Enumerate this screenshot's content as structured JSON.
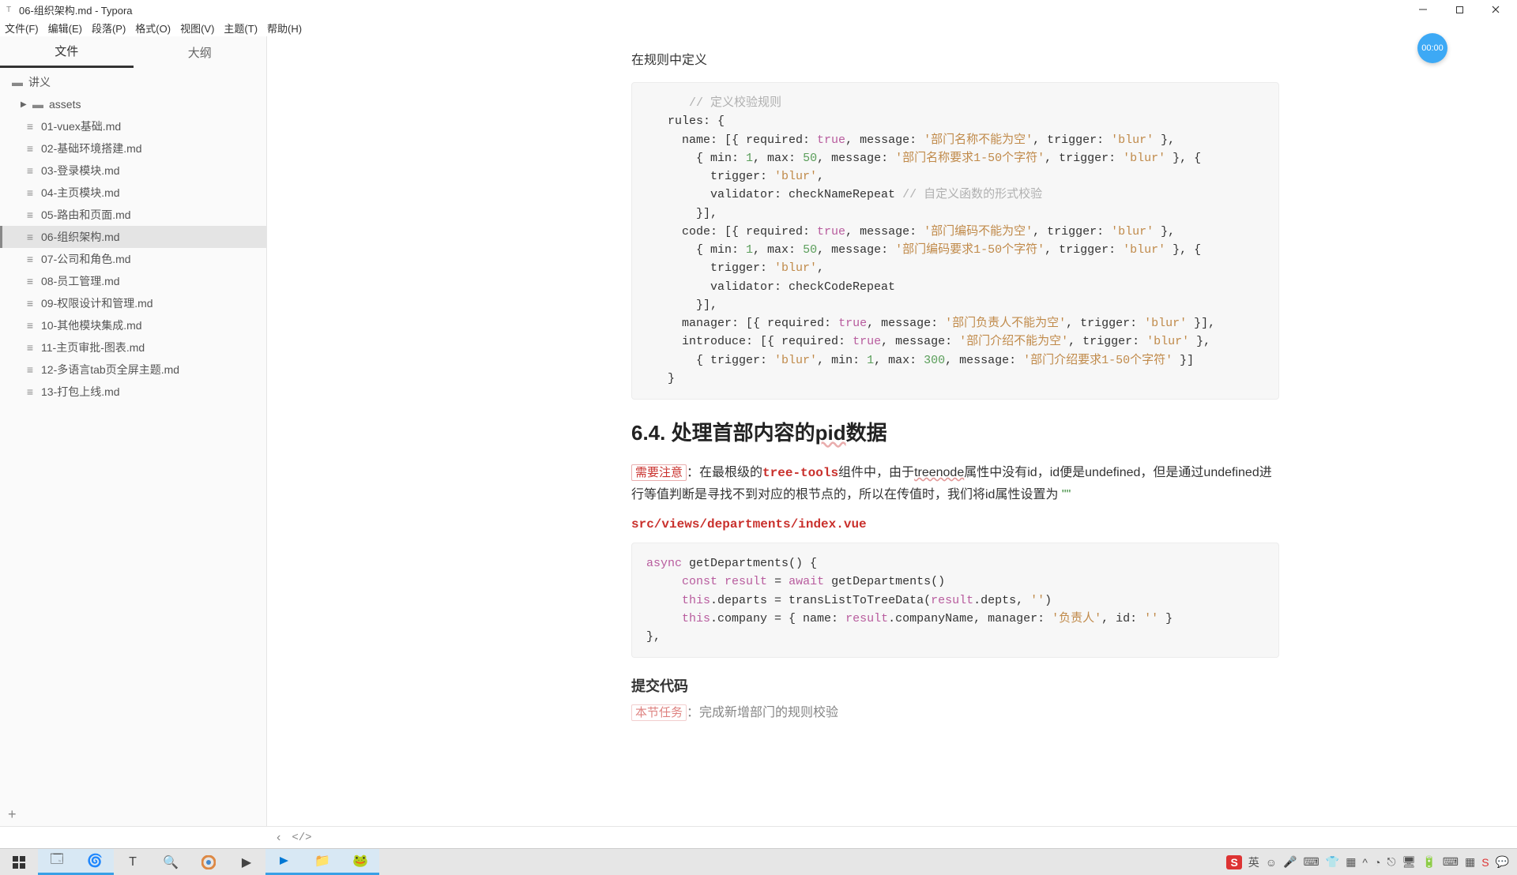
{
  "window": {
    "title": "06-组织架构.md - Typora"
  },
  "menus": [
    "文件(F)",
    "编辑(E)",
    "段落(P)",
    "格式(O)",
    "视图(V)",
    "主题(T)",
    "帮助(H)"
  ],
  "sidebar": {
    "tabs": {
      "files": "文件",
      "outline": "大纲"
    },
    "root": "讲义",
    "folder": "assets",
    "files": [
      "01-vuex基础.md",
      "02-基础环境搭建.md",
      "03-登录模块.md",
      "04-主页模块.md",
      "05-路由和页面.md",
      "06-组织架构.md",
      "07-公司和角色.md",
      "08-员工管理.md",
      "09-权限设计和管理.md",
      "10-其他模块集成.md",
      "11-主页审批-图表.md",
      "12-多语言tab页全屏主题.md",
      "13-打包上线.md"
    ],
    "active_index": 5
  },
  "badge": "00:00",
  "content": {
    "intro_line": "在规则中定义",
    "code1": {
      "line1_comment": "// 定义校验规则",
      "line2": "rules: {",
      "name_label": "name: [{ required: ",
      "true": "true",
      "msg": ", message: ",
      "name_empty": "'部门名称不能为空'",
      "trigger": ", trigger: ",
      "blur": "'blur'",
      "brace_end": " },",
      "min": "{ min: ",
      "one": "1",
      "max": ", max: ",
      "fifty": "50",
      "name_len": "'部门名称要求1-50个字符'",
      "brace_open": " }, {",
      "trigger_only": "trigger: ",
      "comma": ",",
      "validator": "validator: checkNameRepeat ",
      "custom_comment": "// 自定义函数的形式校验",
      "arr_close": "}],",
      "code_label": "code: [{ required: ",
      "code_empty": "'部门编码不能为空'",
      "code_len": "'部门编码要求1-50个字符'",
      "validator2": "validator: checkCodeRepeat",
      "manager_label": "manager: [{ required: ",
      "manager_empty": "'部门负责人不能为空'",
      "arr_close2": " }],",
      "intro_label": "introduce: [{ required: ",
      "intro_empty": "'部门介绍不能为空'",
      "trigger2": "{ trigger: ",
      "min2": ", min: ",
      "max2": ", max: ",
      "three_hundred": "300",
      "intro_len": "'部门介绍要求1-50个字符'",
      "arr_close3": " }]",
      "close_brace": "}"
    },
    "heading": {
      "prefix": "6.4. 处理首部内容的",
      "ul": "pid",
      "suffix": "数据"
    },
    "note_label": "需要注意",
    "para1a": "：在最根级的",
    "tree_tools": "tree-tools",
    "para1b": "组件中，由于",
    "treenode": "treenode",
    "para1c": "属性中没有id，id便是undefined，但是通过undefined进行等值判断是寻找不到对应的根节点的，所以在传值时，我们将id属性设置为",
    "empty_q": "\"\"",
    "srcpath": "src/views/departments/index.vue",
    "code2": {
      "async": "async",
      "fn_sig": " getDepartments() {",
      "const": "const",
      "result": "result",
      "eq": " = ",
      "await": "await",
      "call": " getDepartments()",
      "this": "this",
      "departs": ".departs = transListToTreeData(",
      "result2": "result",
      "depts": ".depts, ",
      "empty": "''",
      "close_p": ")",
      "company": ".company = { name: ",
      "cname": ".companyName, manager: ",
      "mgr": "'负责人'",
      "idpart": ", id: ",
      "end": " }",
      "closer": "},"
    },
    "sub_heading": "提交代码",
    "task_label": "本节任务",
    "task_text": "：完成新增部门的规则校验"
  },
  "tray": {
    "ime1": "S",
    "ime2": "英",
    "chevron": "^"
  }
}
